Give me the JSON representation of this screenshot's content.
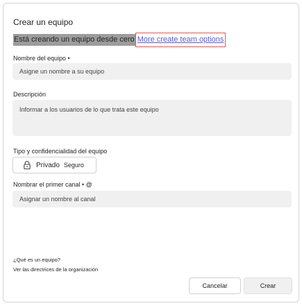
{
  "dialog": {
    "title": "Crear un equipo",
    "subtitle": "Está creando un equipo desde cero",
    "more_options_link": "More create team options"
  },
  "team_name": {
    "label": "Nombre del equipo •",
    "placeholder": "Asigne un nombre a su equipo"
  },
  "description": {
    "label": "Descripción",
    "placeholder": "Informar a los usuarios de lo que trata este equipo"
  },
  "privacy": {
    "label": "Tipo y confidencialidad del equipo",
    "type": "Privado",
    "sensitivity": "Seguro",
    "icon": "lock-icon"
  },
  "channel": {
    "label": "Nombrar el primer canal • @",
    "placeholder": "Asignar un nombre al canal"
  },
  "help_links": {
    "what_is_team": "¿Qué es un equipo?",
    "org_policies": "Ver las directrices de la organización"
  },
  "buttons": {
    "cancel": "Cancelar",
    "create": "Crear"
  }
}
